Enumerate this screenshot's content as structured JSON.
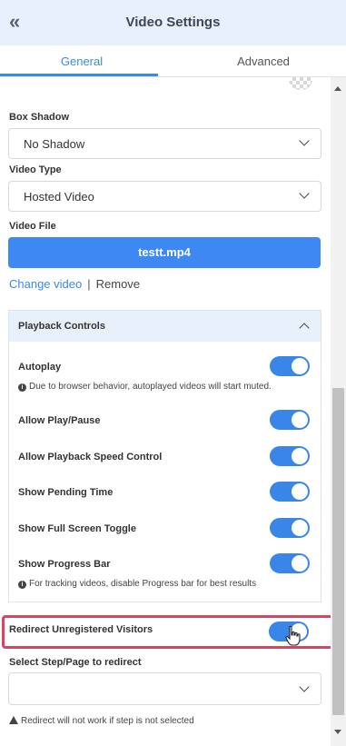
{
  "header": {
    "title": "Video Settings",
    "back_icon": "double-chevron-left"
  },
  "tabs": [
    {
      "label": "General",
      "active": true
    },
    {
      "label": "Advanced",
      "active": false
    }
  ],
  "fields": {
    "box_shadow": {
      "label": "Box Shadow",
      "value": "No Shadow"
    },
    "video_type": {
      "label": "Video Type",
      "value": "Hosted Video"
    },
    "video_file": {
      "label": "Video File",
      "file_name": "testt.mp4",
      "change_link": "Change video",
      "separator": "|",
      "remove_link": "Remove"
    }
  },
  "playback": {
    "title": "Playback Controls",
    "options": [
      {
        "label": "Autoplay",
        "on": true,
        "note": "Due to browser behavior, autoplayed videos will start muted."
      },
      {
        "label": "Allow Play/Pause",
        "on": true
      },
      {
        "label": "Allow Playback Speed Control",
        "on": true
      },
      {
        "label": "Show Pending Time",
        "on": true
      },
      {
        "label": "Show Full Screen Toggle",
        "on": true
      },
      {
        "label": "Show Progress Bar",
        "on": true,
        "note": "For tracking videos, disable Progress bar for best results"
      }
    ]
  },
  "redirect": {
    "label": "Redirect Unregistered Visitors",
    "on": true,
    "select_label": "Select Step/Page to redirect",
    "select_value": "",
    "warning": "Redirect will not work if step is not selected"
  },
  "colors": {
    "accent": "#3a8ae6",
    "toggle_on": "#3a85e8",
    "header_bg": "#e8f0fb",
    "highlight": "#d9455f"
  }
}
